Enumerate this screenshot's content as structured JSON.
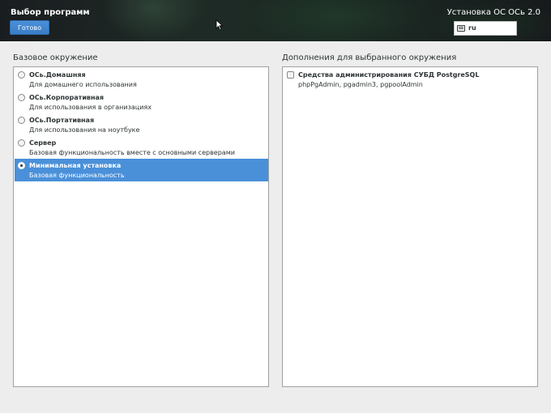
{
  "header": {
    "page_title": "Выбор программ",
    "done_label": "Готово",
    "install_title": "Установка ОС ОСь 2.0",
    "keyboard_layout": "ru"
  },
  "base_env": {
    "label": "Базовое окружение",
    "items": [
      {
        "name": "ОСь.Домашняя",
        "desc": "Для домашнего использования",
        "selected": false
      },
      {
        "name": "ОСь.Корпоративная",
        "desc": "Для использования в организациях",
        "selected": false
      },
      {
        "name": "ОСь.Портативная",
        "desc": "Для использования на ноутбуке",
        "selected": false
      },
      {
        "name": "Сервер",
        "desc": "Базовая функциональность вместе с основными серверами",
        "selected": false
      },
      {
        "name": "Минимальная установка",
        "desc": "Базовая функциональность",
        "selected": true
      }
    ]
  },
  "addons": {
    "label": "Дополнения для выбранного окружения",
    "items": [
      {
        "name": "Средства администрирования СУБД PostgreSQL",
        "desc": "phpPgAdmin, pgadmin3, pgpoolAdmin",
        "checked": false
      }
    ]
  },
  "colors": {
    "accent": "#4a90d9",
    "background": "#ededed"
  }
}
